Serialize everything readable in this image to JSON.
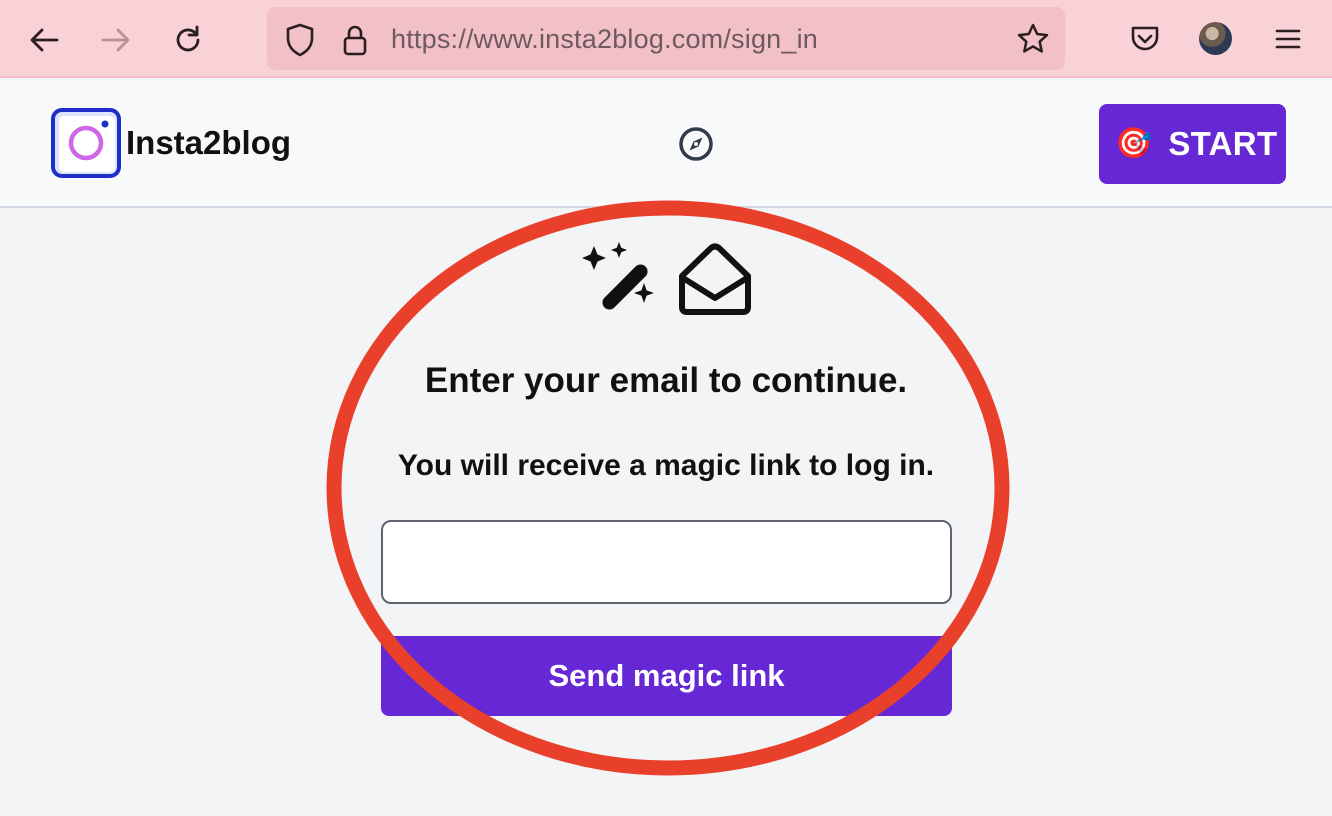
{
  "browser": {
    "url": "https://www.insta2blog.com/sign_in",
    "icons": [
      "back-arrow-icon",
      "forward-arrow-icon",
      "reload-icon",
      "shield-icon",
      "lock-icon",
      "star-icon",
      "pocket-icon",
      "avatar",
      "hamburger-menu-icon"
    ]
  },
  "header": {
    "brand": "Insta2blog",
    "start_label": "START",
    "start_icon": "🎯",
    "accent_color": "#6528d4"
  },
  "main": {
    "heading": "Enter your email to continue.",
    "subheading": "You will receive a magic link to log in.",
    "email_value": "",
    "send_label": "Send magic link",
    "icons": [
      "magic-wand-icon",
      "envelope-open-icon"
    ]
  },
  "annotation": {
    "highlight_color": "#e8402a"
  }
}
